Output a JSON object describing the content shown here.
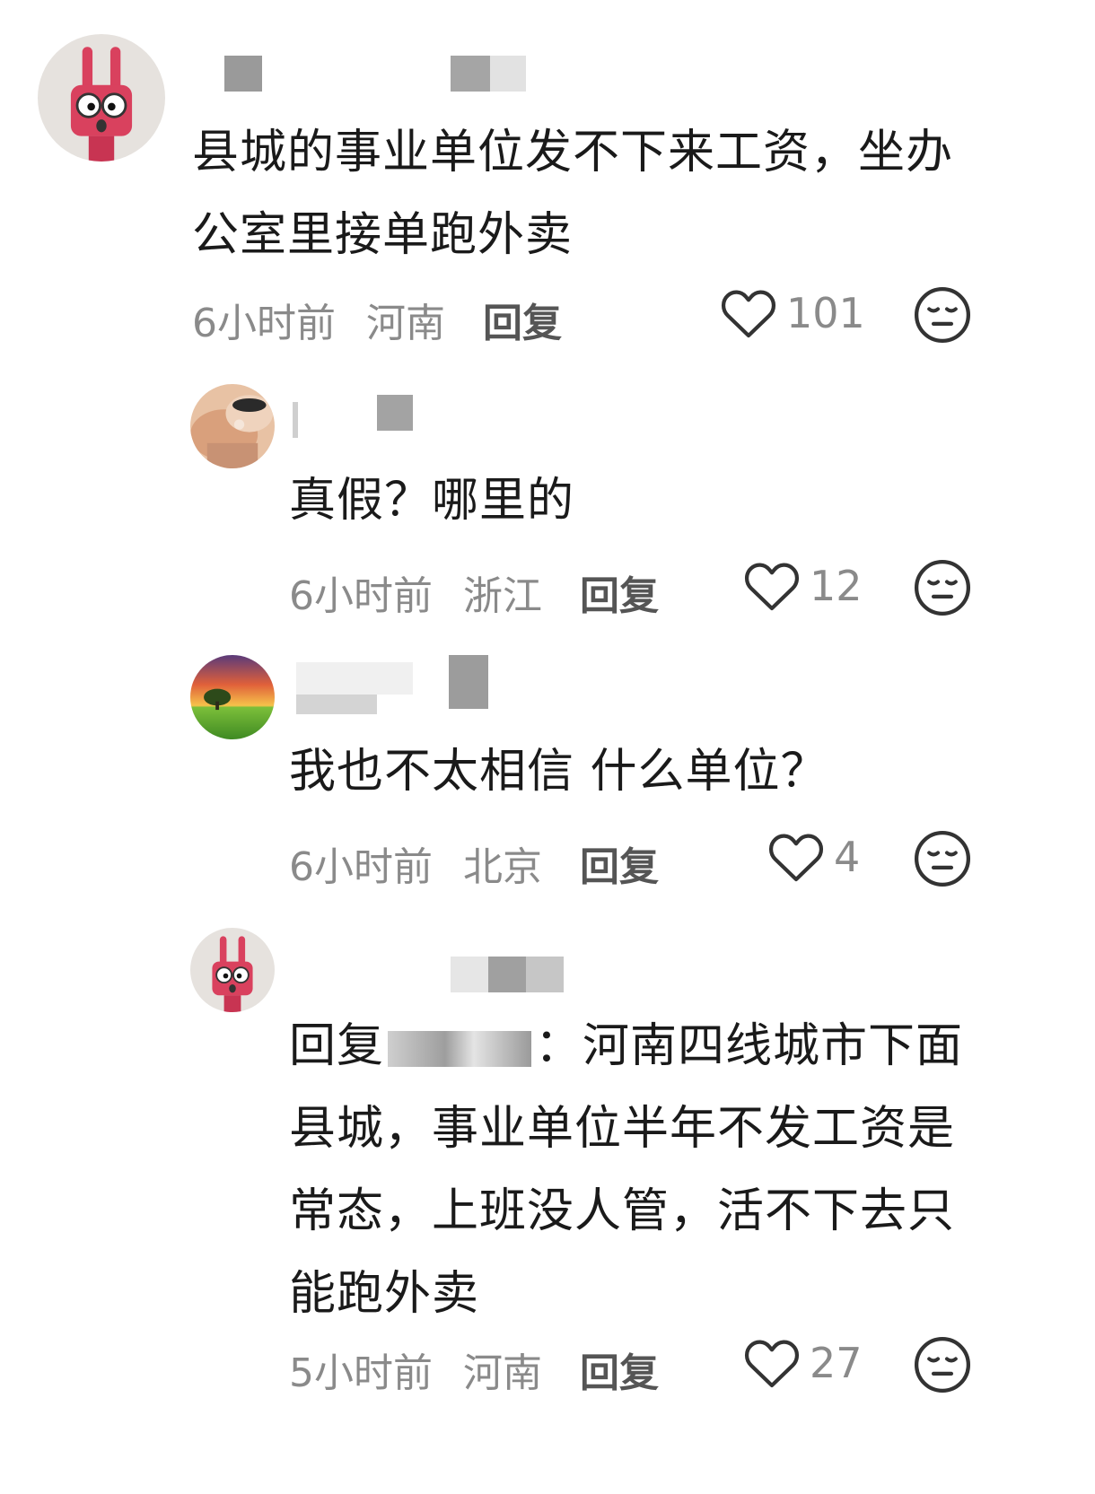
{
  "comments": [
    {
      "text": "县城的事业单位发不下来工资，坐办公室里接单跑外卖",
      "time": "6小时前",
      "location": "河南",
      "reply_label": "回复",
      "likes": "101"
    },
    {
      "text": "真假？哪里的",
      "time": "6小时前",
      "location": "浙江",
      "reply_label": "回复",
      "likes": "12"
    },
    {
      "text": "我也不太相信 什么单位？",
      "time": "6小时前",
      "location": "北京",
      "reply_label": "回复",
      "likes": "4"
    },
    {
      "reply_prefix": "回复",
      "text": "：河南四线城市下面县城，事业单位半年不发工资是常态，上班没人管，活不下去只能跑外卖",
      "time": "5小时前",
      "location": "河南",
      "reply_label": "回复",
      "likes": "27"
    }
  ],
  "icons": {
    "like": "heart-outline-icon",
    "dislike": "meh-face-icon"
  },
  "colors": {
    "meta": "#8a8a8a",
    "avatar_red": "#d9415e"
  }
}
